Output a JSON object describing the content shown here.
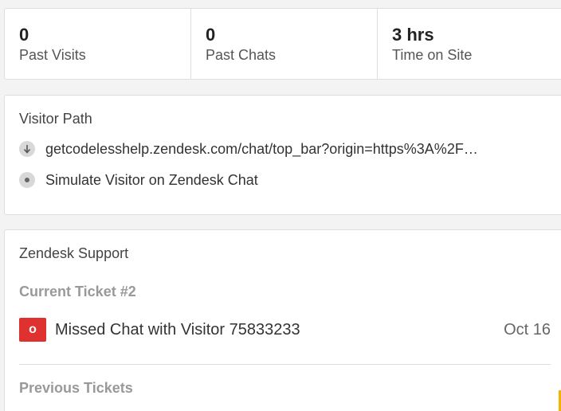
{
  "stats": [
    {
      "value": "0",
      "label": "Past Visits"
    },
    {
      "value": "0",
      "label": "Past Chats"
    },
    {
      "value": "3 hrs",
      "label": "Time on Site"
    }
  ],
  "visitor_path": {
    "title": "Visitor Path",
    "items": [
      {
        "icon": "download-arrow-icon",
        "text": "getcodelesshelp.zendesk.com/chat/top_bar?origin=https%3A%2F…"
      },
      {
        "icon": "dot-icon",
        "text": "Simulate Visitor on Zendesk Chat"
      }
    ]
  },
  "support": {
    "title": "Zendesk Support",
    "current_ticket_label": "Current Ticket #2",
    "ticket": {
      "status_letter": "o",
      "subject": "Missed Chat with Visitor 75833233",
      "date": "Oct 16",
      "status_color": "#e03131"
    },
    "previous_tickets_label": "Previous Tickets"
  }
}
